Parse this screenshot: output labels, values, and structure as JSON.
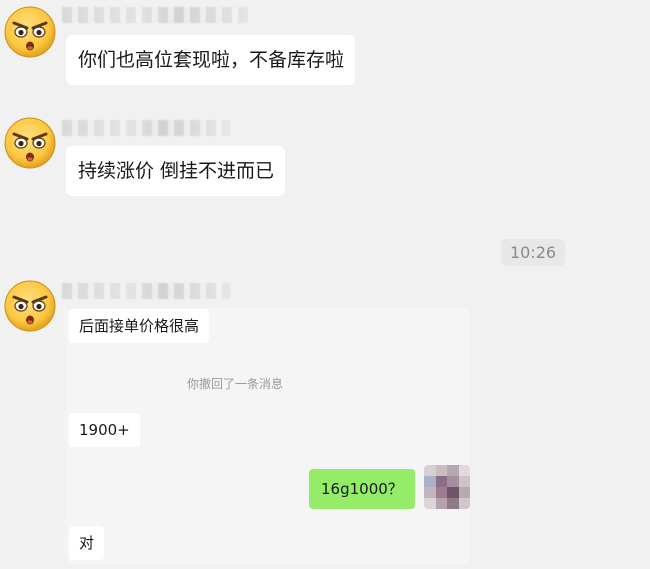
{
  "messages": [
    {
      "sender": "other",
      "text": "你们也高位套现啦，不备库存啦"
    },
    {
      "sender": "other",
      "text": "持续涨价 倒挂不进而已"
    }
  ],
  "timestamp": "10:26",
  "card": {
    "msg1": "后面接单价格很高",
    "recall_notice": "你撤回了一条消息",
    "msg2": "1900+",
    "my_msg": "16g1000？",
    "msg3": "对"
  },
  "colors": {
    "background": "#f1f1f1",
    "bubble_other": "#ffffff",
    "bubble_self": "#95ec69",
    "timestamp_text": "#8a8a8a",
    "recall_text": "#9a9a9a"
  },
  "icons": {
    "sender_avatar": "angry-face-emoji-icon",
    "self_avatar": "pixelated-avatar-icon"
  }
}
